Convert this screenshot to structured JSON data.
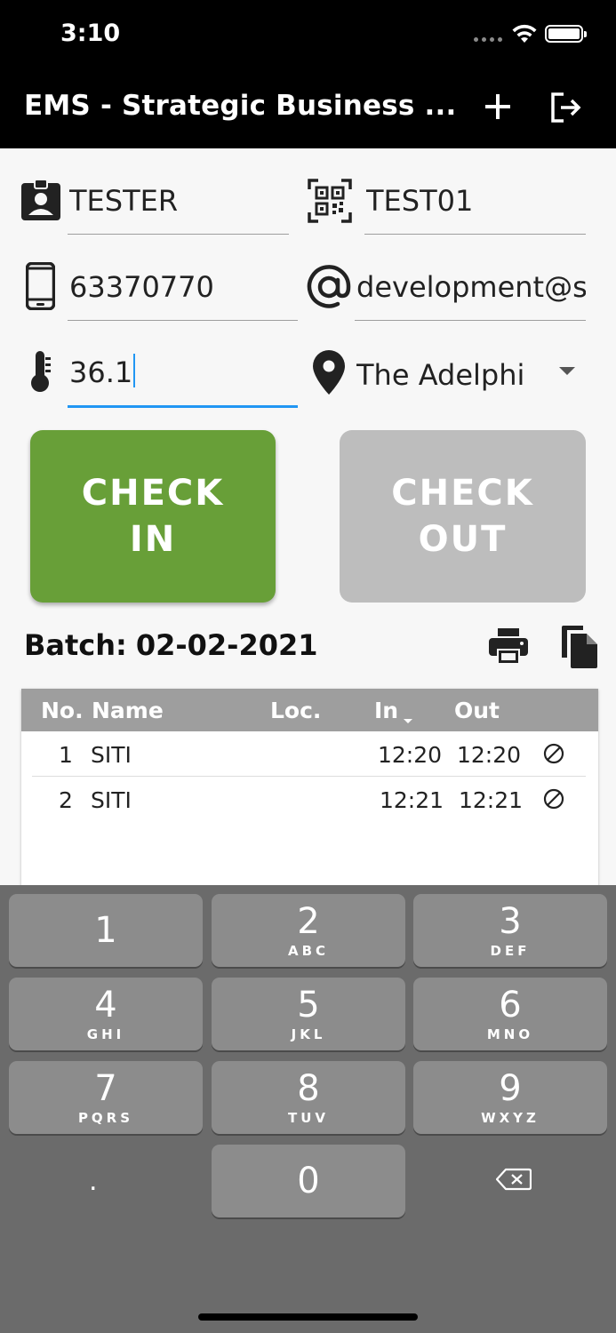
{
  "status_bar": {
    "time": "3:10"
  },
  "app_bar": {
    "title": "EMS - Strategic Business ...",
    "add_icon": "add-icon",
    "logout_icon": "logout-icon"
  },
  "form": {
    "name": "TESTER",
    "id": "TEST01",
    "phone": "63370770",
    "email": "development@st",
    "temperature": "36.1",
    "location": "The Adelphi"
  },
  "buttons": {
    "check_in_line1": "CHECK",
    "check_in_line2": "IN",
    "check_out_line1": "CHECK",
    "check_out_line2": "OUT"
  },
  "batch": {
    "label": "Batch:",
    "date": "02-02-2021"
  },
  "table": {
    "headers": {
      "no": "No.",
      "name": "Name",
      "loc": "Loc.",
      "in": "In",
      "out": "Out"
    },
    "rows": [
      {
        "no": "1",
        "name": "SITI",
        "loc": "",
        "in": "12:20",
        "out": "12:20"
      },
      {
        "no": "2",
        "name": "SITI",
        "loc": "",
        "in": "12:21",
        "out": "12:21"
      }
    ]
  },
  "keypad": {
    "keys": [
      {
        "num": "1",
        "letters": ""
      },
      {
        "num": "2",
        "letters": "ABC"
      },
      {
        "num": "3",
        "letters": "DEF"
      },
      {
        "num": "4",
        "letters": "GHI"
      },
      {
        "num": "5",
        "letters": "JKL"
      },
      {
        "num": "6",
        "letters": "MNO"
      },
      {
        "num": "7",
        "letters": "PQRS"
      },
      {
        "num": "8",
        "letters": "TUV"
      },
      {
        "num": "9",
        "letters": "WXYZ"
      },
      {
        "num": "0",
        "letters": ""
      }
    ],
    "dot": "."
  },
  "colors": {
    "check_in": "#689f38",
    "check_out_disabled": "#bdbdbd",
    "focus": "#2196f3"
  }
}
